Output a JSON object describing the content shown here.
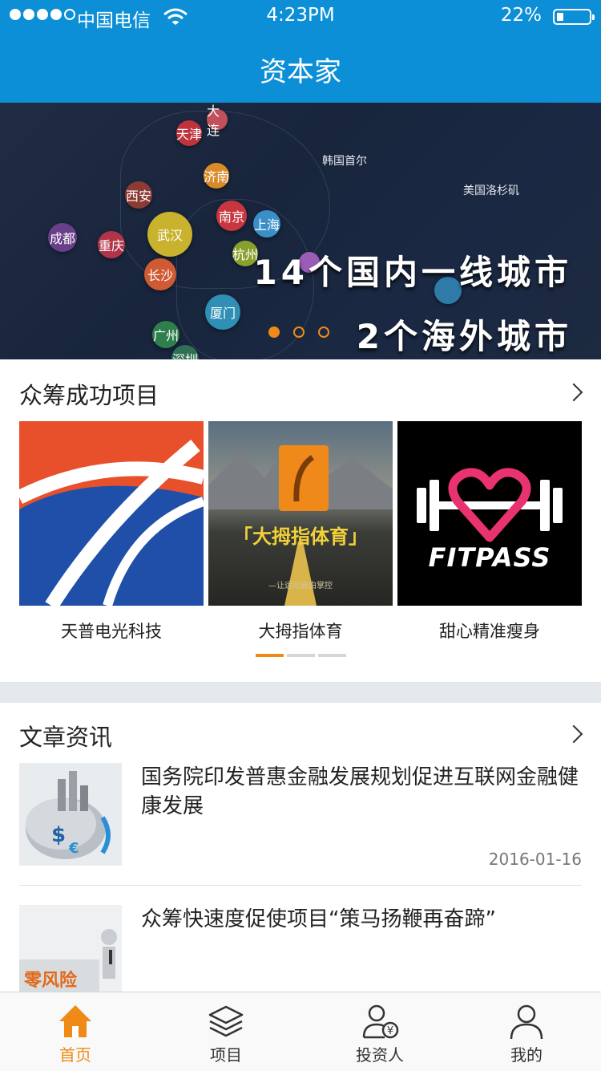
{
  "status_bar": {
    "carrier": "中国电信",
    "time": "4:23PM",
    "battery": "22%",
    "battery_level": 0.22
  },
  "header": {
    "title": "资本家"
  },
  "banner": {
    "cities": [
      "大连",
      "天津",
      "济南",
      "西安",
      "南京",
      "上海",
      "成都",
      "武汉",
      "重庆",
      "杭州",
      "长沙",
      "厦门",
      "广州",
      "深圳"
    ],
    "overseas": [
      "韩国首尔",
      "美国洛杉矶"
    ],
    "line1": "14个国内一线城市",
    "line2": "2个海外城市",
    "slides": 3,
    "active_slide": 0
  },
  "crowdfunding": {
    "title": "众筹成功项目",
    "items": [
      {
        "label": "天普电光科技"
      },
      {
        "label": "大拇指体育",
        "img_text": "「大拇指体育」",
        "img_sub": "—让运动自由掌控"
      },
      {
        "label": "甜心精准瘦身",
        "img_text": "FITPASS"
      }
    ],
    "pages": 3,
    "active_page": 0
  },
  "articles": {
    "title": "文章资讯",
    "items": [
      {
        "title": "国务院印发普惠金融发展规划促进互联网金融健康发展",
        "date": "2016-01-16"
      },
      {
        "title": "众筹快速度促使项目“策马扬鞭再奋蹄”",
        "thumb_text": "零风险"
      }
    ]
  },
  "tabbar": {
    "tabs": [
      {
        "label": "首页",
        "icon": "home-icon",
        "active": true
      },
      {
        "label": "项目",
        "icon": "layers-icon"
      },
      {
        "label": "投资人",
        "icon": "investor-icon"
      },
      {
        "label": "我的",
        "icon": "profile-icon"
      }
    ]
  },
  "colors": {
    "header": "#0c8fd6",
    "accent": "#f08a16"
  }
}
